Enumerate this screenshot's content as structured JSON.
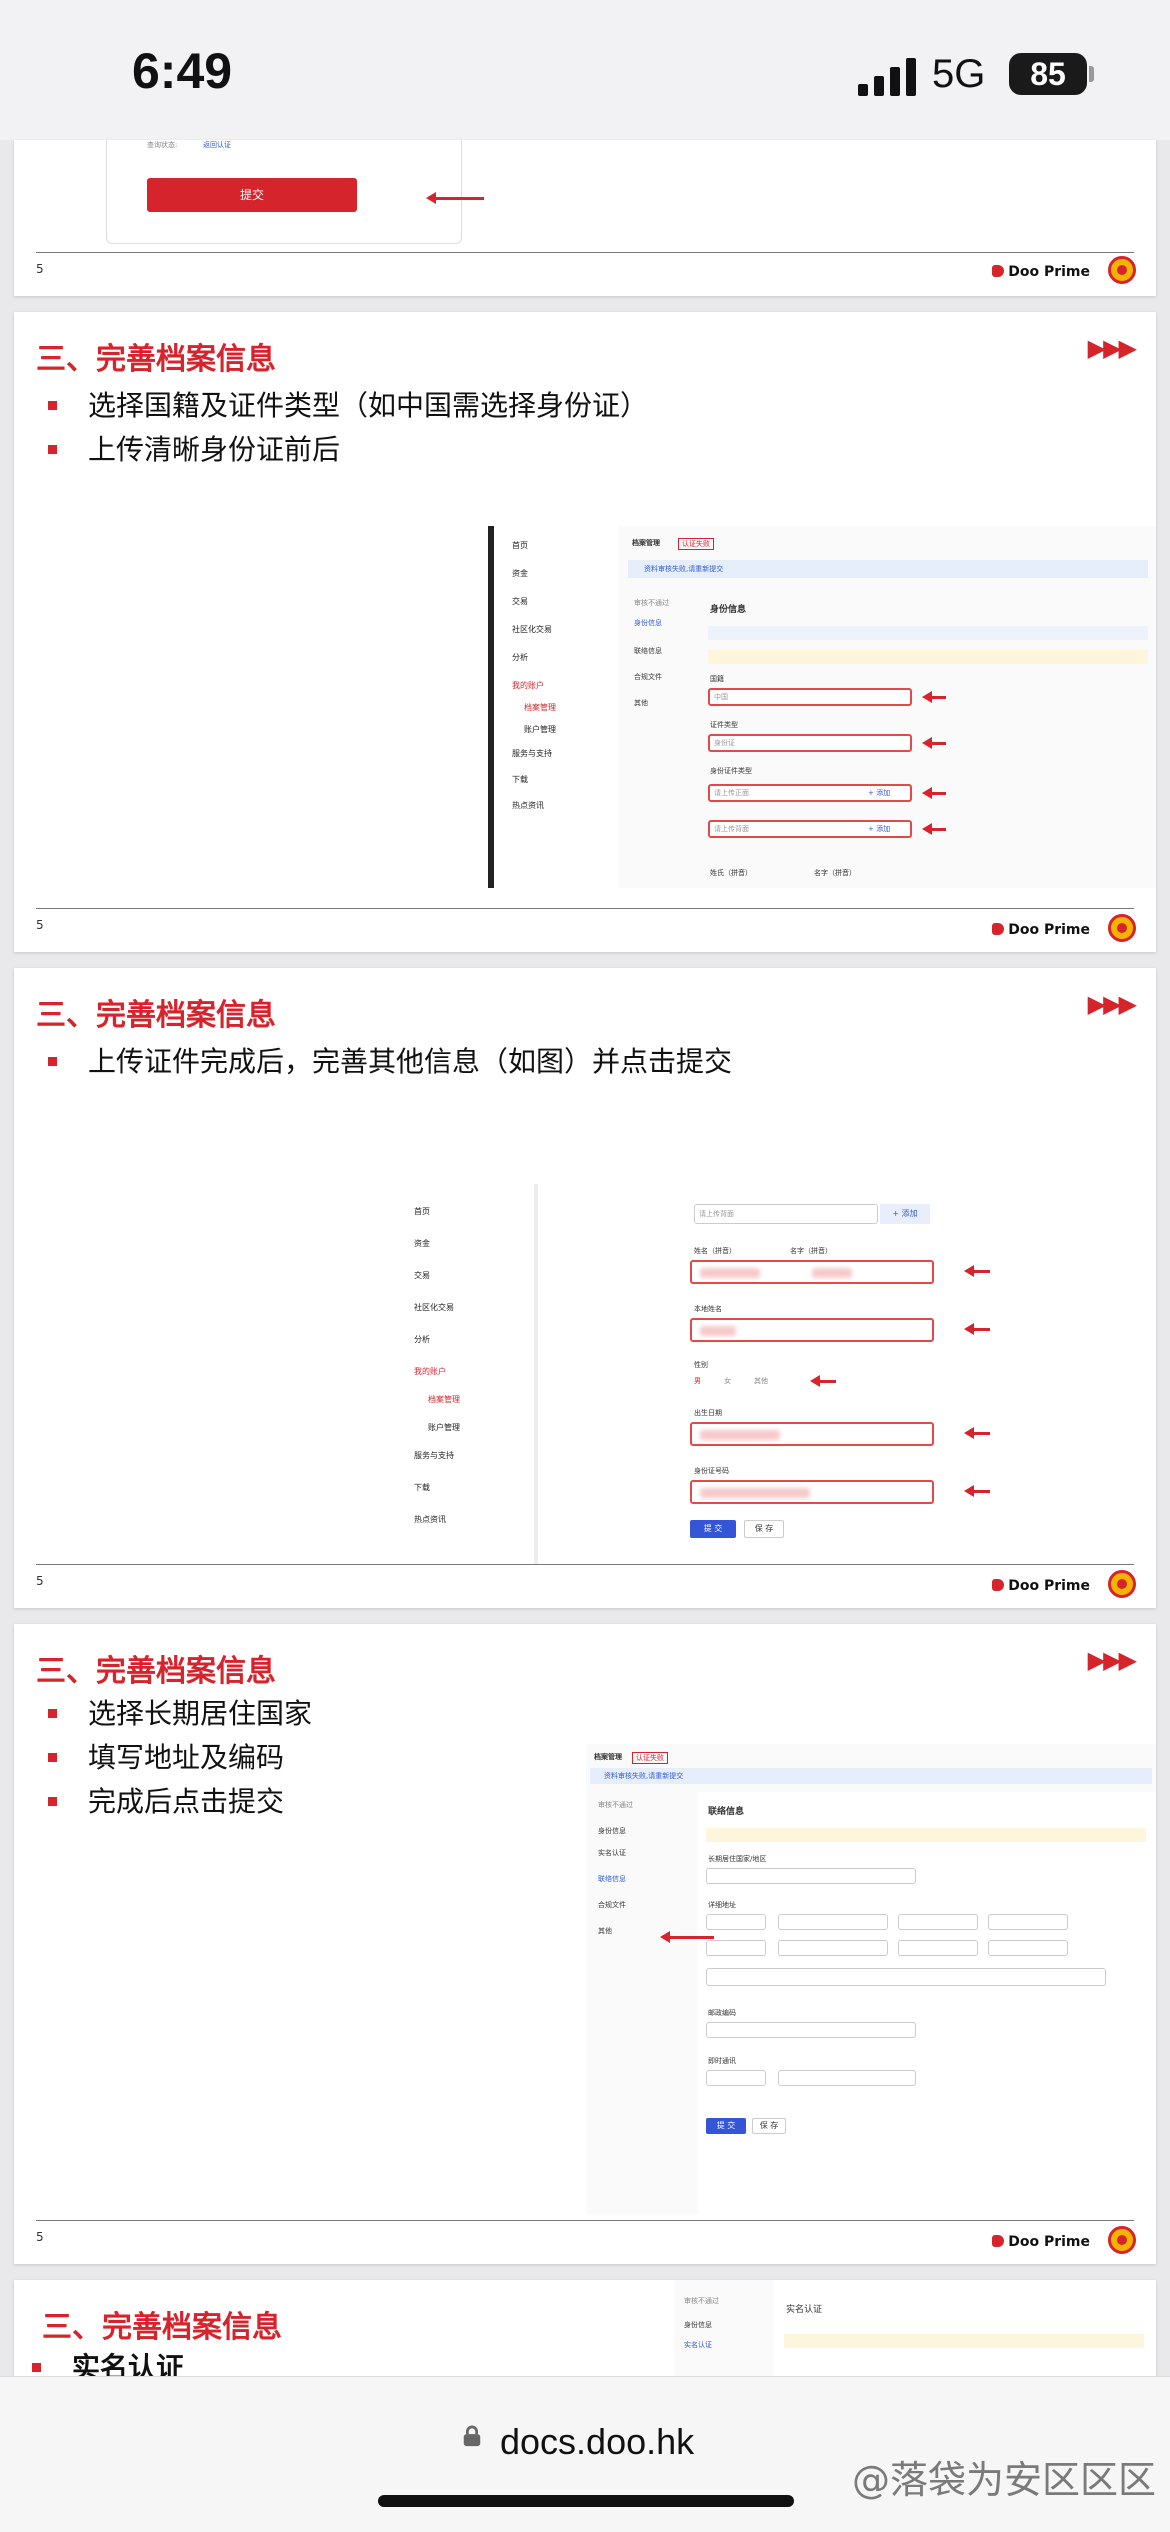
{
  "status": {
    "time": "6:49",
    "network": "5G",
    "battery": "85"
  },
  "slide0": {
    "link_label": "查询状态:",
    "link_text": "返回认证",
    "submit_label": "提交",
    "page": "5",
    "brand": "Doo Prime"
  },
  "slides": [
    {
      "title": "三、完善档案信息",
      "bullets": [
        "选择国籍及证件类型（如中国需选择身份证）",
        "上传清晰身份证前后"
      ],
      "page": "5",
      "brand": "Doo Prime"
    },
    {
      "title": "三、完善档案信息",
      "bullets": [
        "上传证件完成后，完善其他信息（如图）并点击提交"
      ],
      "page": "5",
      "brand": "Doo Prime"
    },
    {
      "title": "三、完善档案信息",
      "bullets": [
        "选择长期居住国家",
        "填写地址及编码",
        "完成后点击提交"
      ],
      "page": "5",
      "brand": "Doo Prime"
    },
    {
      "title": "三、完善档案信息",
      "bullets": [
        "实名认证"
      ]
    }
  ],
  "nav": [
    "首页",
    "资金",
    "交易",
    "社区化交易",
    "分析",
    "我的账户",
    "档案管理",
    "账户管理",
    "服务与支持",
    "下载",
    "热点资讯"
  ],
  "shot1": {
    "header": "档案管理",
    "badge": "认证失败",
    "notice": "资料审核失败,请重新提交",
    "side": [
      "审核不通过",
      "身份信息",
      "联络信息",
      "合规文件",
      "其他"
    ],
    "heading": "身份信息",
    "labels": [
      "国籍",
      "证件类型",
      "身份证件类型"
    ],
    "values": [
      "中国",
      "身份证"
    ],
    "upload1": "请上传正面",
    "upload2": "请上传背面",
    "add": "+ 添加",
    "bottom_labels": [
      "姓氏（拼音）",
      "名字（拼音）"
    ]
  },
  "shot2": {
    "upload": "请上传背面",
    "add": "+ 添加",
    "labels": [
      "姓名（拼音）",
      "名字（拼音）",
      "本地姓名",
      "性别",
      "出生日期",
      "身份证号码"
    ],
    "gender": [
      "男",
      "女",
      "其他"
    ],
    "submit": "提 交",
    "save": "保 存"
  },
  "shot3": {
    "header": "档案管理",
    "badge": "认证失败",
    "notice": "资料审核失败,请重新提交",
    "side": [
      "审核不通过",
      "身份信息",
      "实名认证",
      "联络信息",
      "合规文件",
      "其他"
    ],
    "heading": "联络信息",
    "labels": [
      "长期居住国家/地区",
      "详细地址",
      "邮政编码",
      "即时通讯"
    ],
    "submit": "提 交",
    "save": "保 存"
  },
  "shot4": {
    "side": [
      "审核不通过",
      "身份信息",
      "实名认证"
    ],
    "heading": "实名认证"
  },
  "browser": {
    "url": "docs.doo.hk",
    "watermark": "@落袋为安区区区"
  }
}
